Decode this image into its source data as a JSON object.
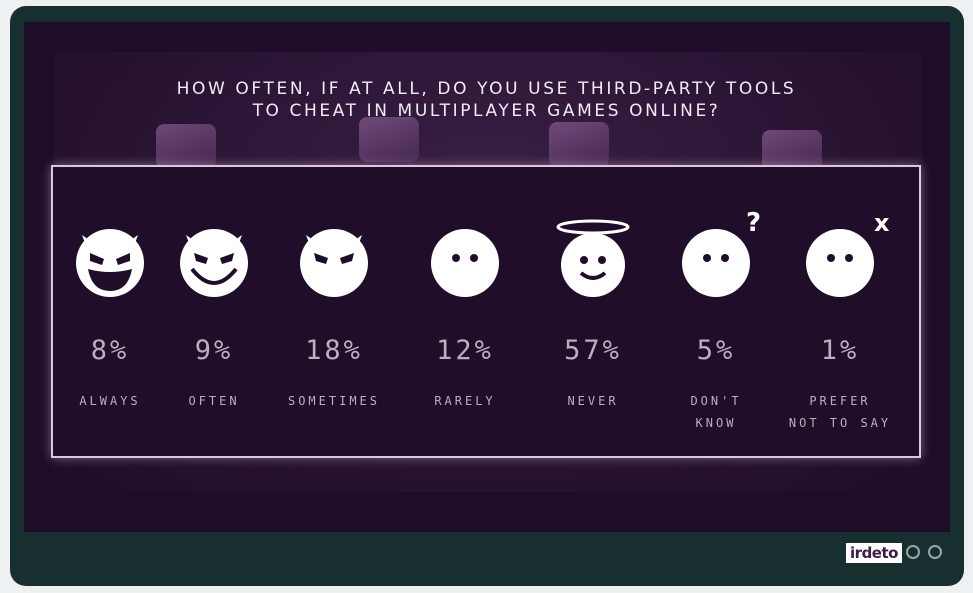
{
  "title_line1": "HOW OFTEN, IF AT ALL, DO YOU USE THIRD-PARTY TOOLS",
  "title_line2": "TO CHEAT IN MULTIPLAYER GAMES ONLINE?",
  "brand": "irdeto",
  "chart_data": {
    "type": "bar",
    "title": "HOW OFTEN, IF AT ALL, DO YOU USE THIRD-PARTY TOOLS TO CHEAT IN MULTIPLAYER GAMES ONLINE?",
    "categories": [
      "ALWAYS",
      "OFTEN",
      "SOMETIMES",
      "RARELY",
      "NEVER",
      "DON'T KNOW",
      "PREFER NOT TO SAY"
    ],
    "values": [
      8,
      9,
      18,
      12,
      57,
      5,
      1
    ],
    "value_labels": [
      "8%",
      "9%",
      "18%",
      "12%",
      "57%",
      "5%",
      "1%"
    ]
  },
  "items": [
    {
      "pct": "8%",
      "label1": "ALWAYS",
      "label2": "",
      "icon": "grinning-devil-icon"
    },
    {
      "pct": "9%",
      "label1": "OFTEN",
      "label2": "",
      "icon": "smirking-devil-icon"
    },
    {
      "pct": "18%",
      "label1": "SOMETIMES",
      "label2": "",
      "icon": "frowning-devil-icon"
    },
    {
      "pct": "12%",
      "label1": "RARELY",
      "label2": "",
      "icon": "neutral-face-icon"
    },
    {
      "pct": "57%",
      "label1": "NEVER",
      "label2": "",
      "icon": "angel-face-icon"
    },
    {
      "pct": "5%",
      "label1": "DON'T",
      "label2": "KNOW",
      "icon": "question-face-icon"
    },
    {
      "pct": "1%",
      "label1": "PREFER",
      "label2": "NOT TO SAY",
      "icon": "x-face-icon"
    }
  ],
  "colors": {
    "background": "#1d0d28",
    "frame": "#17302f",
    "text": "#f1ecf5",
    "muted": "#b9b0be"
  }
}
